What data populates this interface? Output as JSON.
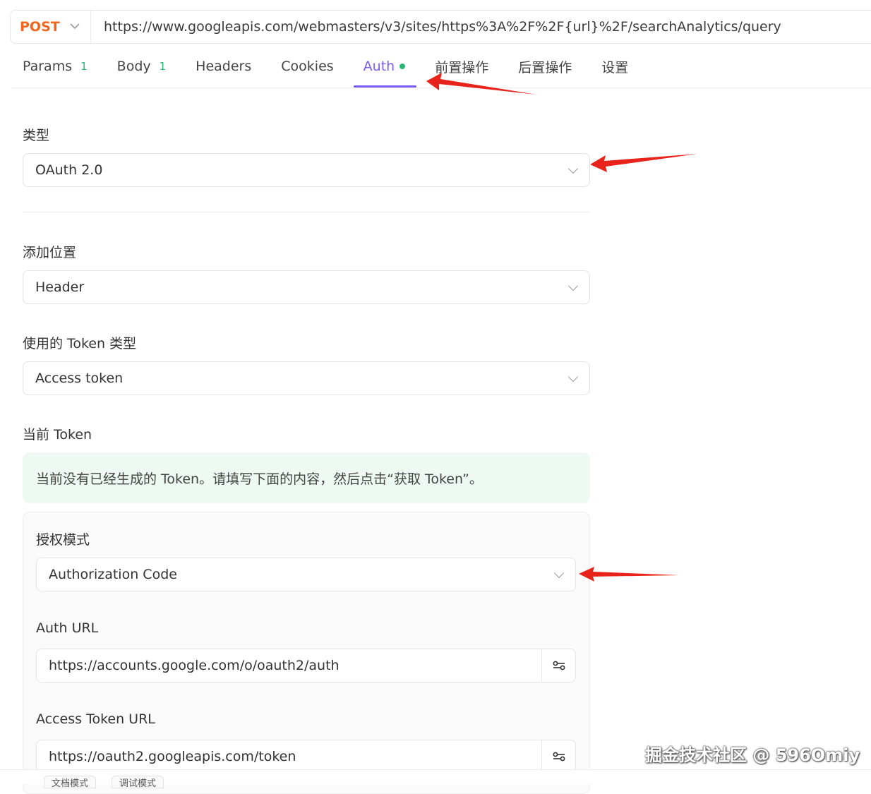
{
  "request": {
    "method": "POST",
    "url": "https://www.googleapis.com/webmasters/v3/sites/https%3A%2F%2F{url}%2F/searchAnalytics/query"
  },
  "tabs": [
    {
      "label": "Params",
      "count": "1"
    },
    {
      "label": "Body",
      "count": "1"
    },
    {
      "label": "Headers"
    },
    {
      "label": "Cookies"
    },
    {
      "label": "Auth",
      "active": true
    },
    {
      "label": "前置操作"
    },
    {
      "label": "后置操作"
    },
    {
      "label": "设置"
    }
  ],
  "auth": {
    "type_label": "类型",
    "type_value": "OAuth 2.0",
    "add_to_label": "添加位置",
    "add_to_value": "Header",
    "token_type_label": "使用的 Token 类型",
    "token_type_value": "Access token",
    "current_token_label": "当前 Token",
    "current_token_notice": "当前没有已经生成的 Token。请填写下面的内容，然后点击“获取 Token”。",
    "grant_type_label": "授权模式",
    "grant_type_value": "Authorization Code",
    "auth_url_label": "Auth URL",
    "auth_url_value": "https://accounts.google.com/o/oauth2/auth",
    "access_token_url_label": "Access Token URL",
    "access_token_url_value": "https://oauth2.googleapis.com/token"
  },
  "bottom_tabs": [
    "文档模式",
    "调试模式"
  ],
  "watermark": "掘金技术社区 @ 596Omiy",
  "colors": {
    "method": "#f0641e",
    "accent": "#7a5cf2",
    "success": "#2bb673",
    "annotation_arrow": "#e8231b"
  }
}
